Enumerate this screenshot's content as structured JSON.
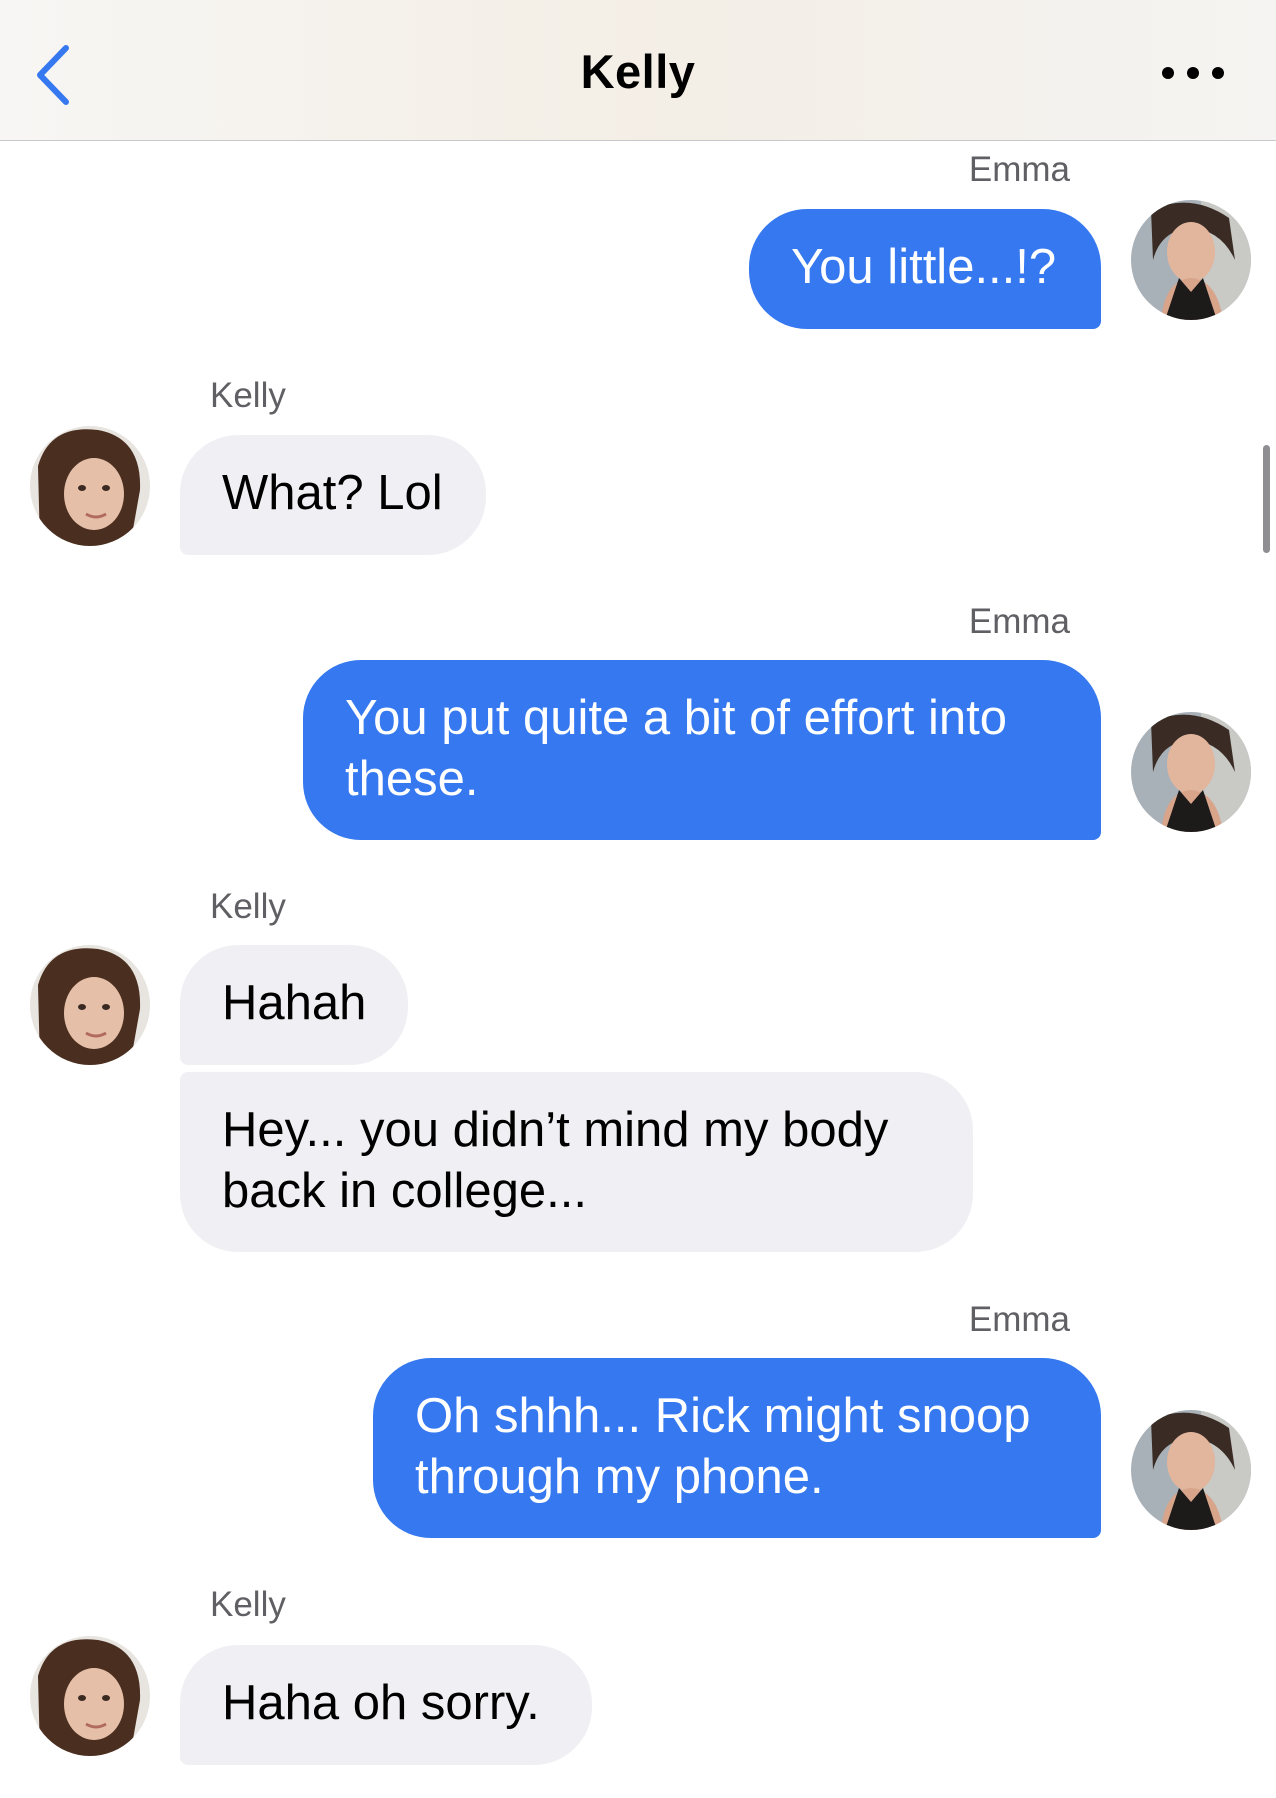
{
  "header": {
    "title": "Kelly",
    "back_icon": "chevron-left-icon",
    "more_icon": "ellipsis-icon",
    "accent_color": "#3578f0"
  },
  "messages": [
    {
      "sender": "Emma",
      "direction": "outgoing",
      "text": "You little...!?"
    },
    {
      "sender": "Kelly",
      "direction": "incoming",
      "text": "What? Lol"
    },
    {
      "sender": "Emma",
      "direction": "outgoing",
      "text": "You put quite a bit of effort into these."
    },
    {
      "sender": "Kelly",
      "direction": "incoming",
      "text": "Hahah"
    },
    {
      "sender": "Kelly",
      "direction": "incoming",
      "text": "Hey... you didn’t mind my body back in college..."
    },
    {
      "sender": "Emma",
      "direction": "outgoing",
      "text": "Oh shhh... Rick might snoop through my phone."
    },
    {
      "sender": "Kelly",
      "direction": "incoming",
      "text": "Haha oh sorry."
    }
  ],
  "colors": {
    "outgoing_bubble": "#3578f0",
    "incoming_bubble": "#f0f0f4"
  }
}
